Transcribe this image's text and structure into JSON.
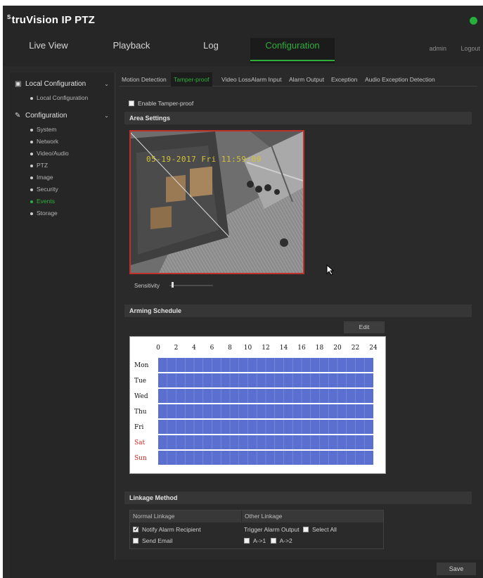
{
  "app": {
    "logo": "truVision IP PTZ",
    "logo_mark": "S"
  },
  "nav": {
    "tabs": [
      {
        "label": "Live View"
      },
      {
        "label": "Playback"
      },
      {
        "label": "Log"
      },
      {
        "label": "Configuration",
        "active": true
      }
    ],
    "user": "admin",
    "logout": "Logout"
  },
  "sidebar": {
    "sections": [
      {
        "label": "Local Configuration",
        "icon": "monitor-icon",
        "items": [
          {
            "label": "Local Configuration"
          }
        ]
      },
      {
        "label": "Configuration",
        "icon": "wrench-icon",
        "items": [
          {
            "label": "System"
          },
          {
            "label": "Network"
          },
          {
            "label": "Video/Audio"
          },
          {
            "label": "PTZ"
          },
          {
            "label": "Image"
          },
          {
            "label": "Security"
          },
          {
            "label": "Events",
            "active": true
          },
          {
            "label": "Storage"
          }
        ]
      }
    ]
  },
  "subtabs": [
    {
      "label": "Motion Detection"
    },
    {
      "label": "Tamper-proof",
      "active": true
    },
    {
      "label": "Video Loss"
    },
    {
      "label": "Alarm Input"
    },
    {
      "label": "Alarm Output"
    },
    {
      "label": "Exception"
    },
    {
      "label": "Audio Exception Detection"
    }
  ],
  "tamper": {
    "enable_label": "Enable Tamper-proof",
    "enabled": false,
    "area_settings": "Area Settings",
    "timestamp": "05-19-2017 Fri 11:59:09",
    "sensitivity_label": "Sensitivity",
    "sensitivity_level": 0.05
  },
  "schedule": {
    "title": "Arming Schedule",
    "edit_label": "Edit",
    "hours": [
      "0",
      "2",
      "4",
      "6",
      "8",
      "10",
      "12",
      "14",
      "16",
      "18",
      "20",
      "22",
      "24"
    ],
    "days": [
      {
        "label": "Mon",
        "weekend": false
      },
      {
        "label": "Tue",
        "weekend": false
      },
      {
        "label": "Wed",
        "weekend": false
      },
      {
        "label": "Thu",
        "weekend": false
      },
      {
        "label": "Fri",
        "weekend": false
      },
      {
        "label": "Sat",
        "weekend": true
      },
      {
        "label": "Sun",
        "weekend": true
      }
    ],
    "armed_hours": [
      0,
      24
    ],
    "armed_color": "#5a6fd0",
    "weekend_color": "#c82424"
  },
  "linkage": {
    "title": "Linkage Method",
    "normal_header": "Normal Linkage",
    "other_header": "Other Linkage",
    "notify_label": "Notify Alarm Recipient",
    "notify_checked": true,
    "email_label": "Send Email",
    "email_checked": false,
    "trigger_label": "Trigger Alarm Output",
    "select_all_label": "Select All",
    "outputs": [
      "A->1",
      "A->2"
    ]
  },
  "footer": {
    "save_label": "Save"
  },
  "colors": {
    "accent": "#2fae3b",
    "background": "#2a2a2a",
    "alert_border": "#c0312b"
  }
}
